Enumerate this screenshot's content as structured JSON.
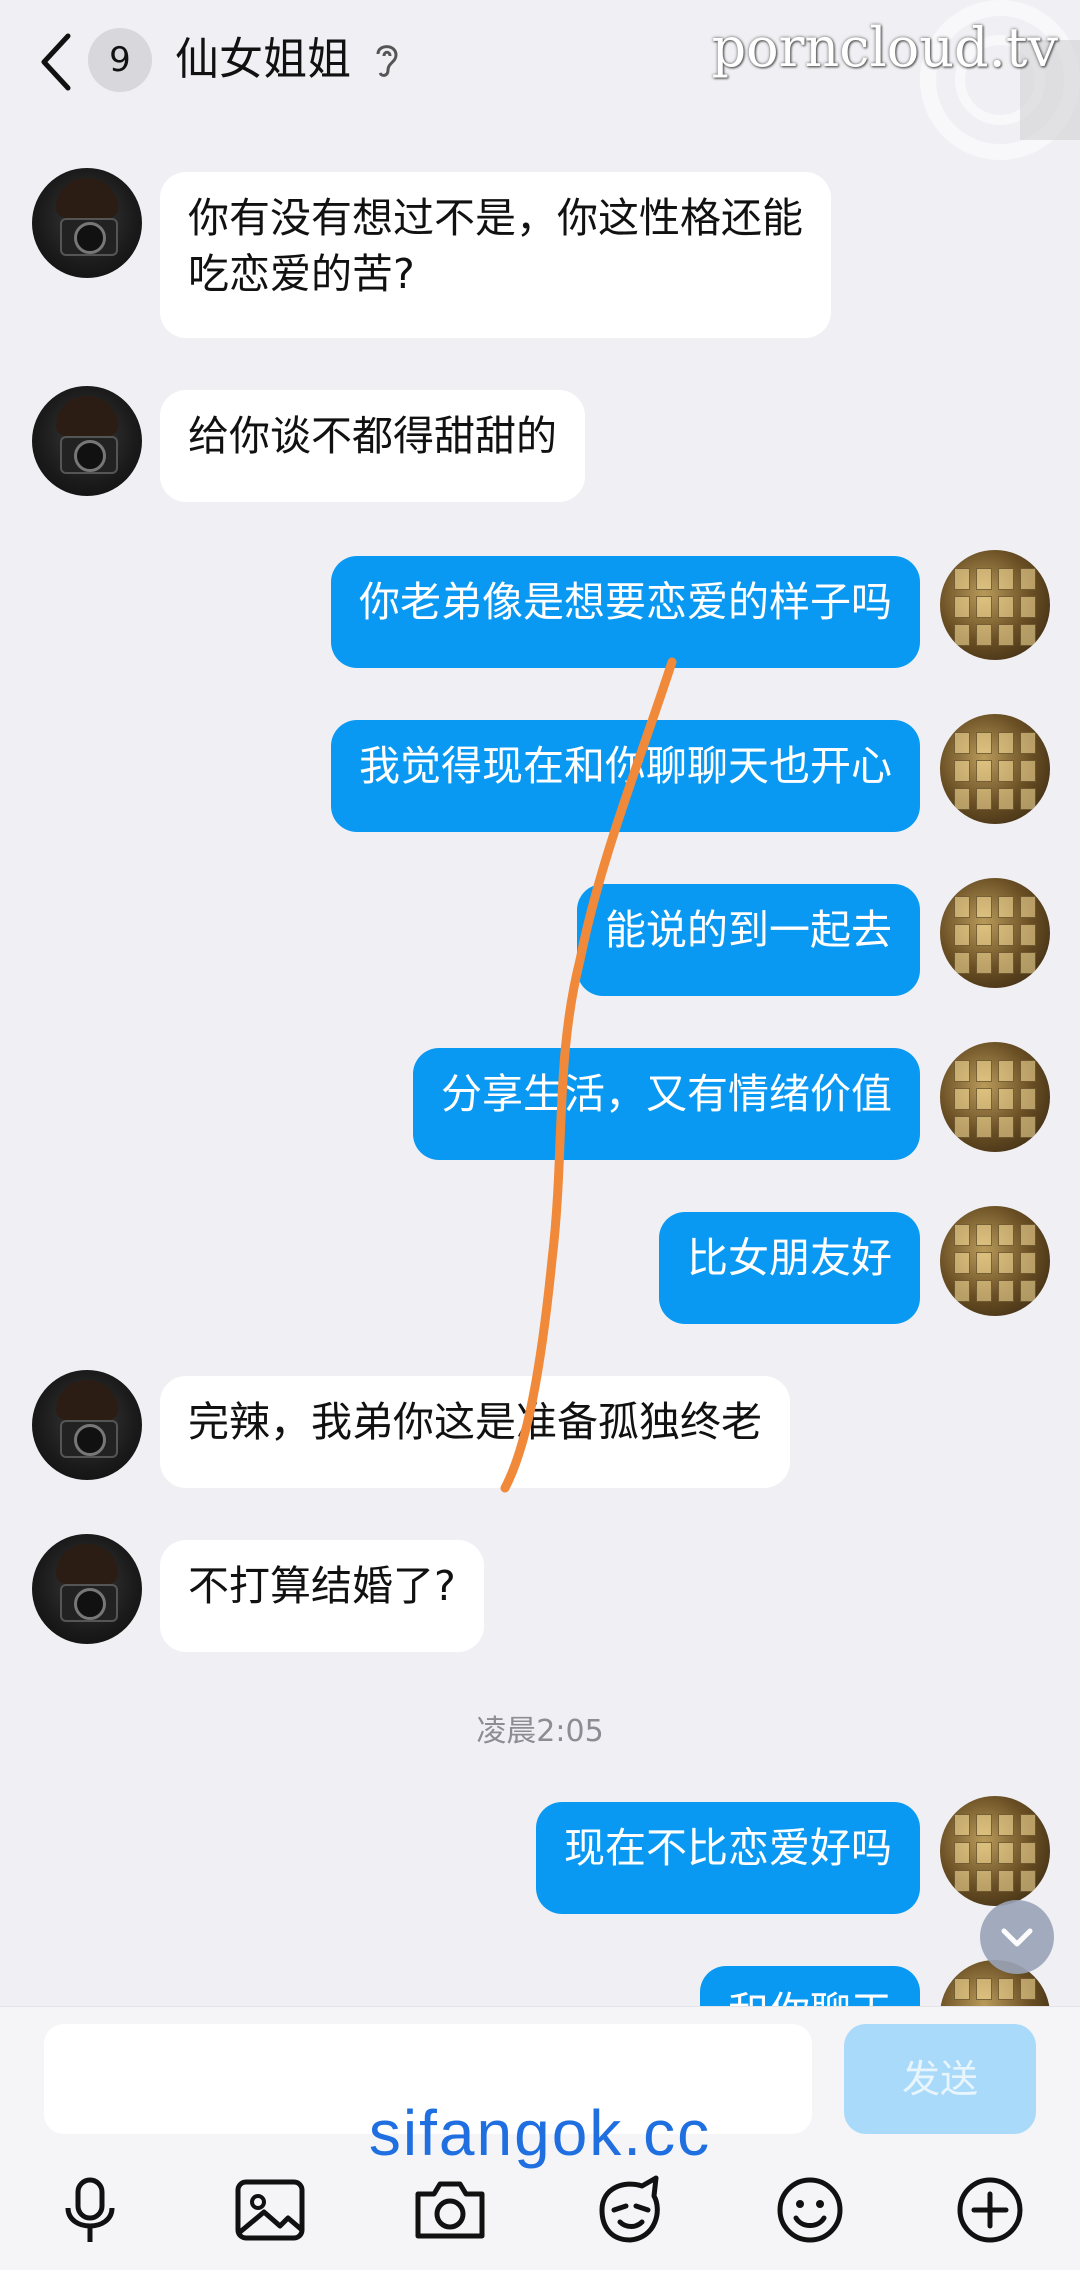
{
  "header": {
    "back_icon": "chevron-left-icon",
    "unread_count": "9",
    "title": "仙女姐姐",
    "ear_icon": "hearing-icon"
  },
  "watermarks": {
    "top": "porncloud.tv",
    "bottom": "sifangok.cc"
  },
  "messages": [
    {
      "side": "left",
      "text": "你有没有想过不是，你这性格还能\n吃恋爱的苦?"
    },
    {
      "side": "left",
      "text": "给你谈不都得甜甜的"
    },
    {
      "side": "right",
      "text": "你老弟像是想要恋爱的样子吗"
    },
    {
      "side": "right",
      "text": "我觉得现在和你聊聊天也开心"
    },
    {
      "side": "right",
      "text": "能说的到一起去"
    },
    {
      "side": "right",
      "text": "分享生活，又有情绪价值"
    },
    {
      "side": "right",
      "text": "比女朋友好"
    },
    {
      "side": "left",
      "text": "完辣，我弟你这是准备孤独终老"
    },
    {
      "side": "left",
      "text": "不打算结婚了?"
    },
    {
      "side": "right",
      "text": "现在不比恋爱好吗"
    },
    {
      "side": "right",
      "text": "和你聊天"
    }
  ],
  "timestamp": "凌晨2:05",
  "composer": {
    "input_placeholder": "",
    "send_label": "发送"
  },
  "toolbar": [
    {
      "icon": "microphone-icon"
    },
    {
      "icon": "image-icon"
    },
    {
      "icon": "camera-icon"
    },
    {
      "icon": "sticker-icon"
    },
    {
      "icon": "emoji-icon"
    },
    {
      "icon": "plus-icon"
    }
  ],
  "colors": {
    "outgoing_bubble": "#0a99f2",
    "incoming_bubble": "#ffffff",
    "background": "#f0f0f4",
    "send_disabled": "#a9daf9",
    "annotation_line": "#f08a3a"
  }
}
